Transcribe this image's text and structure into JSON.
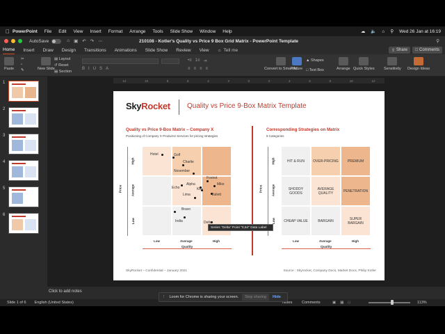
{
  "menubar": {
    "app": "PowerPoint",
    "items": [
      "File",
      "Edit",
      "View",
      "Insert",
      "Format",
      "Arrange",
      "Tools",
      "Slide Show",
      "Window",
      "Help"
    ],
    "datetime": "Wed 26 Jan at 16:19"
  },
  "titlebar": {
    "autosave_label": "AutoSave",
    "toggle_state": "OFF",
    "document_title": "210108 - Kotler's Quality vs Price 9 Box Grid Matrix - PowerPoint Template"
  },
  "tabs": {
    "items": [
      "Home",
      "Insert",
      "Draw",
      "Design",
      "Transitions",
      "Animations",
      "Slide Show",
      "Review",
      "View"
    ],
    "active": "Home",
    "tell_me": "Tell me",
    "share": "Share",
    "comments": "Comments"
  },
  "ribbon": {
    "paste": "Paste",
    "new_slide": "New Slide",
    "layout": "Layout",
    "reset": "Reset",
    "section": "Section",
    "convert": "Convert to SmartArt",
    "picture": "Picture",
    "shapes": "Shapes",
    "text_box": "Text Box",
    "arrange": "Arrange",
    "quick_styles": "Quick Styles",
    "sensitivity": "Sensitivity",
    "design_ideas": "Design Ideas"
  },
  "thumbs": [
    "1",
    "2",
    "3",
    "4",
    "5",
    "6"
  ],
  "slide": {
    "logo_a": "Sky",
    "logo_b": "Rocket",
    "title": "Quality vs Price 9-Box Matrix Template",
    "left": {
      "title": "Quality vs Price 9-Box Matrix – Company X",
      "subtitle": "Positioning of Company X Products/ Services for pricing strategies",
      "points": [
        "Hotel",
        "Golf",
        "Charlie",
        "November",
        "Foxtrot",
        "Alpha",
        "Mike",
        "Echo",
        "Kilo",
        "Juliett",
        "Lima",
        "Bravo",
        "India",
        "Delta"
      ]
    },
    "right": {
      "title": "Corresponding Strategies on Matrix",
      "subtitle": "9 Categories",
      "cells": [
        "HIT & RUN",
        "OVER-PRICING",
        "PREMIUM",
        "SHODDY GOODS",
        "AVERAGE QUALITY",
        "PENETRATION",
        "CHEAP VALUE",
        "BARGAIN",
        "SUPER BARGAIN"
      ]
    },
    "axis": {
      "price": "Price",
      "quality": "Quality",
      "high": "High",
      "average": "Average",
      "low": "Low"
    },
    "footer_left": "SkyRocket – Confidential – January 2021",
    "footer_right": "Source : Skyrocket, Company Docs, Market Docs, Philip Kotler",
    "tooltip": "Series \"Delta\" Point \"0,64\" Data Label"
  },
  "notes": "Click to add notes",
  "status": {
    "slide": "Slide 1 of 6",
    "language": "English (United States)",
    "notes": "Notes",
    "comments": "Comments",
    "zoom": "113%"
  },
  "share_banner": {
    "message": "Loom for Chrome is sharing your screen.",
    "stop": "Stop sharing",
    "hide": "Hide"
  }
}
